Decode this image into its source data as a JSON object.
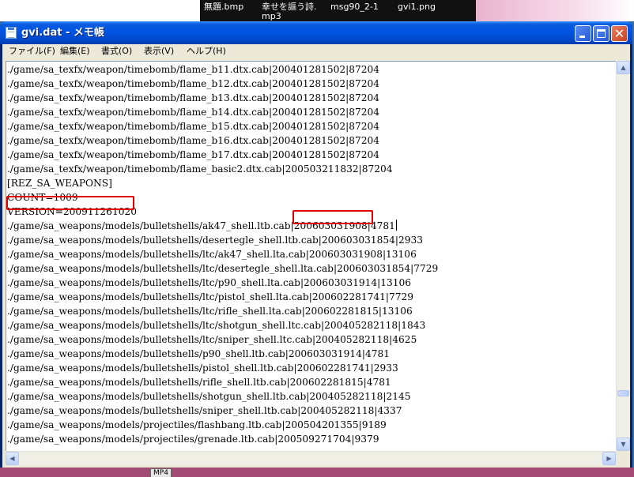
{
  "desktop": {
    "files": [
      "無題.bmp",
      "幸せを謳う詩.mp3",
      "msg90_2-1",
      "gvi1.png"
    ],
    "taskbar_label": "MP4"
  },
  "window": {
    "title": "gvi.dat - メモ帳",
    "menu": [
      "ファイル(F)",
      "編集(E)",
      "書式(O)",
      "表示(V)",
      "ヘルプ(H)"
    ]
  },
  "editor": {
    "lines": [
      "./game/sa_texfx/weapon/timebomb/flame_b11.dtx.cab|200401281502|87204",
      "./game/sa_texfx/weapon/timebomb/flame_b12.dtx.cab|200401281502|87204",
      "./game/sa_texfx/weapon/timebomb/flame_b13.dtx.cab|200401281502|87204",
      "./game/sa_texfx/weapon/timebomb/flame_b14.dtx.cab|200401281502|87204",
      "./game/sa_texfx/weapon/timebomb/flame_b15.dtx.cab|200401281502|87204",
      "./game/sa_texfx/weapon/timebomb/flame_b16.dtx.cab|200401281502|87204",
      "./game/sa_texfx/weapon/timebomb/flame_b17.dtx.cab|200401281502|87204",
      "./game/sa_texfx/weapon/timebomb/flame_basic2.dtx.cab|200503211832|87204",
      "[REZ_SA_WEAPONS]",
      "COUNT=1009",
      "VERSION=200911261020",
      "./game/sa_weapons/models/bulletshells/ak47_shell.ltb.cab|200603031908|4781",
      "./game/sa_weapons/models/bulletshells/desertegle_shell.ltb.cab|200603031854|2933",
      "./game/sa_weapons/models/bulletshells/ltc/ak47_shell.lta.cab|200603031908|13106",
      "./game/sa_weapons/models/bulletshells/ltc/desertegle_shell.lta.cab|200603031854|7729",
      "./game/sa_weapons/models/bulletshells/ltc/p90_shell.lta.cab|200603031914|13106",
      "./game/sa_weapons/models/bulletshells/ltc/pistol_shell.lta.cab|200602281741|7729",
      "./game/sa_weapons/models/bulletshells/ltc/rifle_shell.lta.cab|200602281815|13106",
      "./game/sa_weapons/models/bulletshells/ltc/shotgun_shell.ltc.cab|200405282118|1843",
      "./game/sa_weapons/models/bulletshells/ltc/sniper_shell.ltc.cab|200405282118|4625",
      "./game/sa_weapons/models/bulletshells/p90_shell.ltb.cab|200603031914|4781",
      "./game/sa_weapons/models/bulletshells/pistol_shell.ltb.cab|200602281741|2933",
      "./game/sa_weapons/models/bulletshells/rifle_shell.ltb.cab|200602281815|4781",
      "./game/sa_weapons/models/bulletshells/shotgun_shell.ltb.cab|200405282118|2145",
      "./game/sa_weapons/models/bulletshells/sniper_shell.ltb.cab|200405282118|4337",
      "./game/sa_weapons/models/projectiles/flashbang.ltb.cab|200504201355|9189",
      "./game/sa_weapons/models/projectiles/grenade.ltb.cab|200509271704|9379"
    ],
    "caret_line": 11,
    "highlights": [
      "VERSION=200911261020",
      "200603031908"
    ],
    "highlight_color": "#e00000"
  },
  "icons": {
    "title": "notepad-icon",
    "minimize": "minimize-icon",
    "maximize": "maximize-icon",
    "close": "close-icon",
    "scroll_up": "arrow-up-icon",
    "scroll_down": "arrow-down-icon",
    "scroll_left": "arrow-left-icon",
    "scroll_right": "arrow-right-icon"
  },
  "colors": {
    "titlebar": "#0054e3",
    "menubar": "#ece9d8",
    "close_button": "#c44322"
  }
}
